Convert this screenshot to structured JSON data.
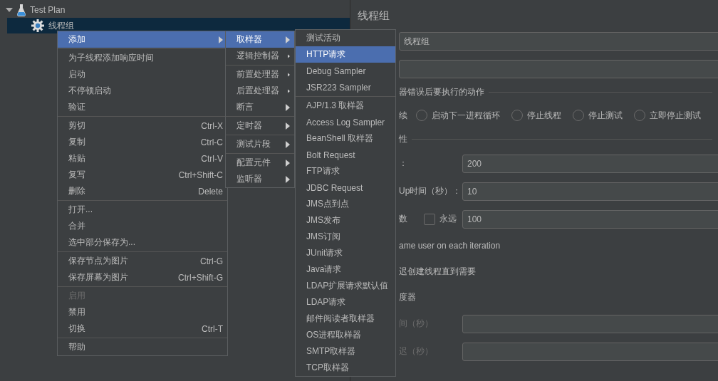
{
  "tree": [
    {
      "kind": "test-plan",
      "label": "Test Plan",
      "expanded": true,
      "selected": false,
      "children": [
        {
          "kind": "thread-group",
          "label": "线程组",
          "selected": true
        }
      ]
    }
  ],
  "panel": {
    "title": "线程组",
    "name_value": "线程组",
    "error_action": {
      "legend": "器错误后要执行的动作",
      "partial_option": "续",
      "options": [
        {
          "label": "启动下一进程循环",
          "selected": false
        },
        {
          "label": "停止线程",
          "selected": false
        },
        {
          "label": "停止测试",
          "selected": false
        },
        {
          "label": "立即停止测试",
          "selected": false
        }
      ]
    },
    "thread_props": {
      "legend": "性",
      "rows": [
        {
          "kind": "field",
          "label": "：",
          "value": "200",
          "disabled": false
        },
        {
          "kind": "field",
          "label": "Up时间（秒）：",
          "value": "10",
          "disabled": false
        },
        {
          "kind": "loop",
          "label": "数",
          "checkbox": {
            "label": "永远",
            "checked": false
          },
          "value": "100",
          "disabled": false
        },
        {
          "kind": "text",
          "label": "ame user on each iteration",
          "disabled": false
        },
        {
          "kind": "text",
          "label": "迟创建线程直到需要",
          "disabled": false
        },
        {
          "kind": "text",
          "label": "度器",
          "disabled": false
        },
        {
          "kind": "field",
          "label": "间（秒）",
          "disabled": true
        },
        {
          "kind": "field",
          "label": "迟（秒）",
          "disabled": true
        }
      ]
    }
  },
  "menus": [
    {
      "groups": [
        [
          {
            "label": "添加",
            "selected": true,
            "has_submenu": true
          }
        ],
        [
          {
            "label": "为子线程添加响应时间",
            "selected": false
          },
          {
            "label": "启动",
            "selected": false
          },
          {
            "label": "不停顿启动",
            "selected": false
          },
          {
            "label": "验证",
            "selected": false
          }
        ],
        [
          {
            "label": "剪切",
            "shortcut": "Ctrl-X",
            "selected": false
          },
          {
            "label": "复制",
            "shortcut": "Ctrl-C",
            "selected": false
          },
          {
            "label": "粘贴",
            "shortcut": "Ctrl-V",
            "selected": false
          },
          {
            "label": "复写",
            "shortcut": "Ctrl+Shift-C",
            "selected": false
          },
          {
            "label": "删除",
            "shortcut": "Delete",
            "selected": false
          }
        ],
        [
          {
            "label": "打开...",
            "selected": false
          },
          {
            "label": "合并",
            "selected": false
          },
          {
            "label": "选中部分保存为...",
            "selected": false
          }
        ],
        [
          {
            "label": "保存节点为图片",
            "shortcut": "Ctrl-G",
            "selected": false
          },
          {
            "label": "保存屏幕为图片",
            "shortcut": "Ctrl+Shift-G",
            "selected": false
          }
        ],
        [
          {
            "label": "启用",
            "selected": false,
            "disabled": true
          },
          {
            "label": "禁用",
            "selected": false
          },
          {
            "label": "切换",
            "shortcut": "Ctrl-T",
            "selected": false
          }
        ],
        [
          {
            "label": "帮助",
            "selected": false
          }
        ]
      ]
    },
    {
      "groups": [
        [
          {
            "label": "取样器",
            "selected": true,
            "has_submenu": true
          },
          {
            "label": "逻辑控制器",
            "selected": false,
            "has_submenu": true
          }
        ],
        [
          {
            "label": "前置处理器",
            "selected": false,
            "has_submenu": true
          },
          {
            "label": "后置处理器",
            "selected": false,
            "has_submenu": true
          },
          {
            "label": "断言",
            "selected": false,
            "has_submenu": true
          }
        ],
        [
          {
            "label": "定时器",
            "selected": false,
            "has_submenu": true
          }
        ],
        [
          {
            "label": "测试片段",
            "selected": false,
            "has_submenu": true
          }
        ],
        [
          {
            "label": "配置元件",
            "selected": false,
            "has_submenu": true
          },
          {
            "label": "监听器",
            "selected": false,
            "has_submenu": true
          }
        ]
      ]
    },
    {
      "groups": [
        [
          {
            "label": "测试活动",
            "selected": false
          },
          {
            "label": "HTTP请求",
            "selected": true
          },
          {
            "label": "Debug Sampler",
            "selected": false
          },
          {
            "label": "JSR223 Sampler",
            "selected": false
          }
        ],
        [
          {
            "label": "AJP/1.3 取样器",
            "selected": false
          },
          {
            "label": "Access Log Sampler",
            "selected": false
          },
          {
            "label": "BeanShell 取样器",
            "selected": false
          },
          {
            "label": "Bolt Request",
            "selected": false
          },
          {
            "label": "FTP请求",
            "selected": false
          },
          {
            "label": "JDBC Request",
            "selected": false
          },
          {
            "label": "JMS点到点",
            "selected": false
          },
          {
            "label": "JMS发布",
            "selected": false
          },
          {
            "label": "JMS订阅",
            "selected": false
          },
          {
            "label": "JUnit请求",
            "selected": false
          },
          {
            "label": "Java请求",
            "selected": false
          },
          {
            "label": "LDAP扩展请求默认值",
            "selected": false
          },
          {
            "label": "LDAP请求",
            "selected": false
          },
          {
            "label": "邮件阅读者取样器",
            "selected": false
          },
          {
            "label": "OS进程取样器",
            "selected": false
          },
          {
            "label": "SMTP取样器",
            "selected": false
          },
          {
            "label": "TCP取样器",
            "selected": false
          }
        ]
      ]
    }
  ]
}
